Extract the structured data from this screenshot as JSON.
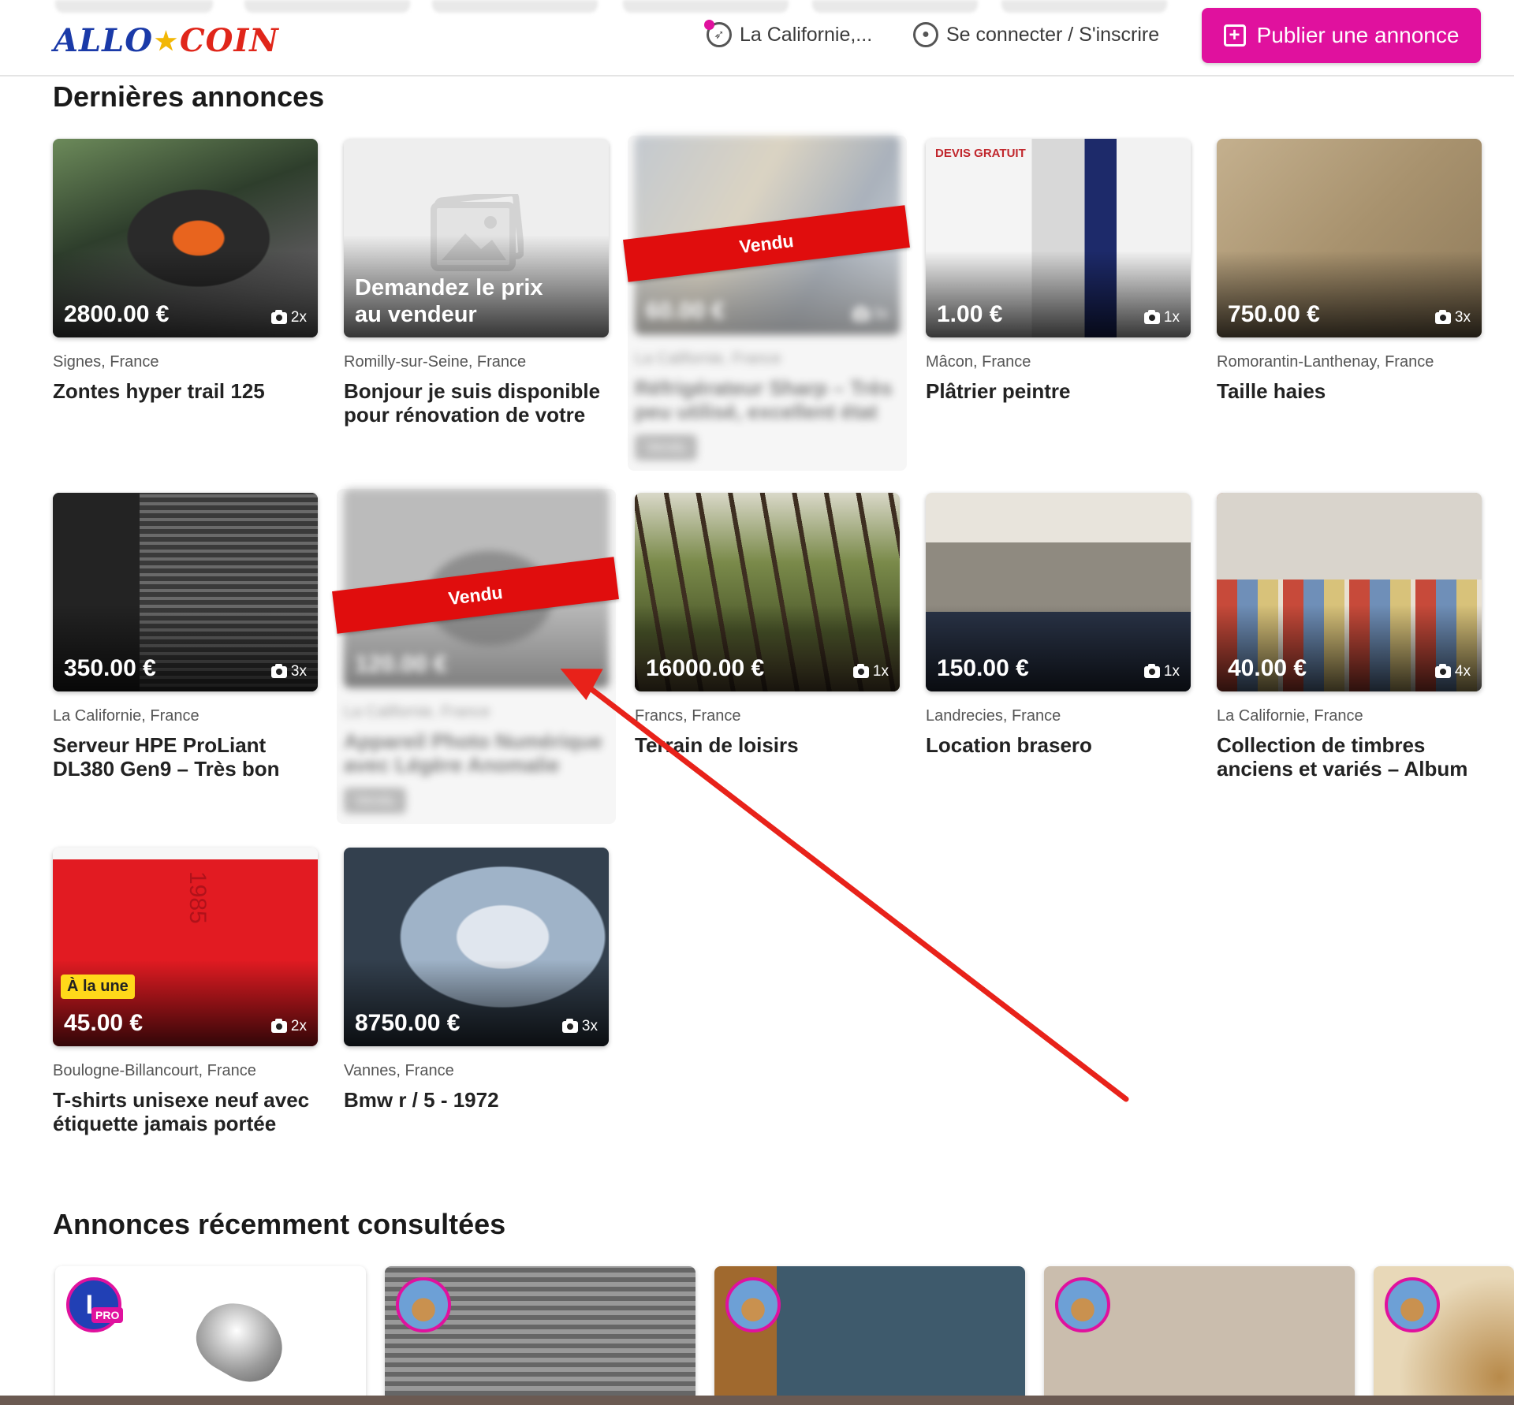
{
  "header": {
    "logo_part1": "ALLO",
    "logo_star": "★",
    "logo_part2": "COIN",
    "location": "La Californie,...",
    "login": "Se connecter / S'inscrire",
    "publish": "Publier une annonce",
    "publish_icon": "plus-square-icon",
    "accent_color": "#e0119e"
  },
  "sections": {
    "latest": "Dernières annonces",
    "recent": "Annonces récemment consultées"
  },
  "listings": [
    {
      "price": "2800.00 €",
      "photos": "2x",
      "location": "Signes, France",
      "title": "Zontes hyper trail 125"
    },
    {
      "ask_price": "Demandez le prix au vendeur",
      "location": "Romilly-sur-Seine, France",
      "title": "Bonjour je suis disponible pour rénovation de votre"
    },
    {
      "price": "60.00 €",
      "photos": "3x",
      "location": "La Californie, France",
      "title": "Réfrigérateur Sharp – Très peu utilisé, excellent état",
      "ribbon": "Vendu",
      "sold_tag": "Vendu"
    },
    {
      "price": "1.00 €",
      "photos": "1x",
      "location": "Mâcon, France",
      "title": "Plâtrier peintre"
    },
    {
      "price": "750.00 €",
      "photos": "3x",
      "location": "Romorantin-Lanthenay, France",
      "title": "Taille haies"
    },
    {
      "price": "350.00 €",
      "photos": "3x",
      "location": "La Californie, France",
      "title": "Serveur HPE ProLiant DL380 Gen9 – Très bon"
    },
    {
      "price": "120.00 €",
      "photos": "",
      "location": "La Californie, France",
      "title": "Appareil Photo Numérique avec Légère Anomalie",
      "ribbon": "Vendu",
      "sold_tag": "Vendu"
    },
    {
      "price": "16000.00 €",
      "photos": "1x",
      "location": "Francs, France",
      "title": "Terrain de loisirs"
    },
    {
      "price": "150.00 €",
      "photos": "1x",
      "location": "Landrecies, France",
      "title": "Location brasero"
    },
    {
      "price": "40.00 €",
      "photos": "4x",
      "location": "La Californie, France",
      "title": "Collection de timbres anciens et variés – Album"
    },
    {
      "price": "45.00 €",
      "photos": "2x",
      "location": "Boulogne-Billancourt, France",
      "title": "T-shirts unisexe neuf avec étiquette jamais portée",
      "badge": "À la une"
    },
    {
      "price": "8750.00 €",
      "photos": "3x",
      "location": "Vannes, France",
      "title": "Bmw r / 5 - 1972"
    }
  ],
  "recent": {
    "pro_label": "PRO"
  }
}
